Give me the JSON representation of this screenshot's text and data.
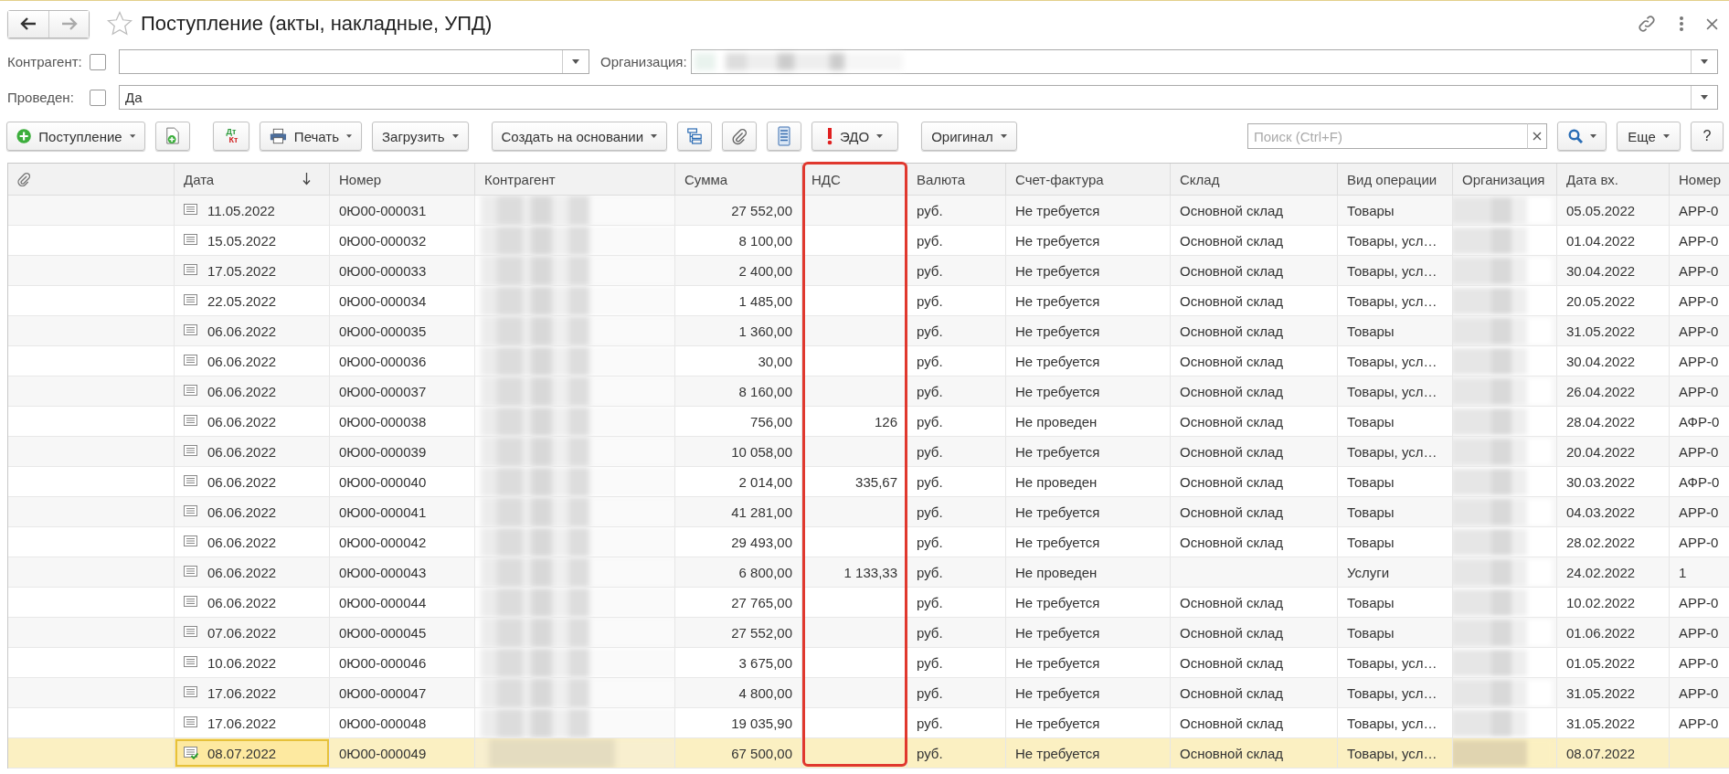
{
  "window": {
    "title": "Поступление (акты, накладные, УПД)"
  },
  "filters": {
    "counterparty": {
      "label": "Контрагент:",
      "checked": false
    },
    "organization": {
      "label": "Организация:"
    },
    "posted": {
      "label": "Проведен:",
      "checked": false,
      "value": "Да"
    }
  },
  "toolbar": [
    {
      "kind": "create",
      "label": "Поступление",
      "dropdown": true
    },
    {
      "kind": "copy"
    },
    {
      "kind": "dtkt",
      "label_top": "Дт",
      "label_bottom": "Кт"
    },
    {
      "kind": "print",
      "label": "Печать",
      "dropdown": true
    },
    {
      "kind": "text",
      "label": "Загрузить",
      "dropdown": true
    },
    {
      "kind": "text",
      "label": "Создать на основании",
      "dropdown": true
    },
    {
      "kind": "structure"
    },
    {
      "kind": "attach"
    },
    {
      "kind": "list"
    },
    {
      "kind": "edo",
      "label": "ЭДО",
      "dropdown": true
    },
    {
      "kind": "text",
      "label": "Оригинал",
      "dropdown": true
    }
  ],
  "search": {
    "placeholder": "Поиск (Ctrl+F)"
  },
  "more_button": {
    "label": "Еще"
  },
  "help_button": {
    "label": "?"
  },
  "table": {
    "columns": [
      {
        "kind": "attachment"
      },
      {
        "label": "Дата",
        "sorted": true
      },
      {
        "label": "Номер"
      },
      {
        "label": "Контрагент",
        "kind": "blurred"
      },
      {
        "label": "Сумма"
      },
      {
        "label": "НДС",
        "highlight": true
      },
      {
        "label": "Валюта"
      },
      {
        "label": "Счет-фактура"
      },
      {
        "label": "Склад"
      },
      {
        "label": "Вид операции"
      },
      {
        "label": "Организация",
        "kind": "blurred"
      },
      {
        "label": "Дата вх."
      },
      {
        "label": "Номер"
      }
    ],
    "rows": [
      {
        "date": "11.05.2022",
        "number": "0Ю00-000031",
        "amount": "27 552,00",
        "currency": "руб.",
        "invoice": "Не требуется",
        "warehouse": "Основной склад",
        "operation": "Товары",
        "date_in": "05.05.2022",
        "number_in": "АРР-0",
        "posted": false,
        "selected": false
      },
      {
        "date": "15.05.2022",
        "number": "0Ю00-000032",
        "amount": "8 100,00",
        "currency": "руб.",
        "invoice": "Не требуется",
        "warehouse": "Основной склад",
        "operation": "Товары, усл…",
        "date_in": "01.04.2022",
        "number_in": "АРР-0",
        "posted": false,
        "selected": false
      },
      {
        "date": "17.05.2022",
        "number": "0Ю00-000033",
        "amount": "2 400,00",
        "currency": "руб.",
        "invoice": "Не требуется",
        "warehouse": "Основной склад",
        "operation": "Товары, усл…",
        "date_in": "30.04.2022",
        "number_in": "АРР-0",
        "posted": false,
        "selected": false
      },
      {
        "date": "22.05.2022",
        "number": "0Ю00-000034",
        "amount": "1 485,00",
        "currency": "руб.",
        "invoice": "Не требуется",
        "warehouse": "Основной склад",
        "operation": "Товары, усл…",
        "date_in": "20.05.2022",
        "number_in": "АРР-0",
        "posted": false,
        "selected": false
      },
      {
        "date": "06.06.2022",
        "number": "0Ю00-000035",
        "amount": "1 360,00",
        "currency": "руб.",
        "invoice": "Не требуется",
        "warehouse": "Основной склад",
        "operation": "Товары",
        "date_in": "31.05.2022",
        "number_in": "АРР-0",
        "posted": false,
        "selected": false
      },
      {
        "date": "06.06.2022",
        "number": "0Ю00-000036",
        "amount": "30,00",
        "currency": "руб.",
        "invoice": "Не требуется",
        "warehouse": "Основной склад",
        "operation": "Товары, усл…",
        "date_in": "30.04.2022",
        "number_in": "АРР-0",
        "posted": false,
        "selected": false
      },
      {
        "date": "06.06.2022",
        "number": "0Ю00-000037",
        "amount": "8 160,00",
        "currency": "руб.",
        "invoice": "Не требуется",
        "warehouse": "Основной склад",
        "operation": "Товары, усл…",
        "date_in": "26.04.2022",
        "number_in": "АРР-0",
        "posted": false,
        "selected": false
      },
      {
        "date": "06.06.2022",
        "number": "0Ю00-000038",
        "amount": "756,00",
        "vat": "126",
        "currency": "руб.",
        "invoice": "Не проведен",
        "warehouse": "Основной склад",
        "operation": "Товары",
        "date_in": "28.04.2022",
        "number_in": "АФР-0",
        "posted": false,
        "selected": false
      },
      {
        "date": "06.06.2022",
        "number": "0Ю00-000039",
        "amount": "10 058,00",
        "currency": "руб.",
        "invoice": "Не требуется",
        "warehouse": "Основной склад",
        "operation": "Товары, усл…",
        "date_in": "20.04.2022",
        "number_in": "АРР-0",
        "posted": false,
        "selected": false
      },
      {
        "date": "06.06.2022",
        "number": "0Ю00-000040",
        "amount": "2 014,00",
        "vat": "335,67",
        "currency": "руб.",
        "invoice": "Не проведен",
        "warehouse": "Основной склад",
        "operation": "Товары",
        "date_in": "30.03.2022",
        "number_in": "АФР-0",
        "posted": false,
        "selected": false
      },
      {
        "date": "06.06.2022",
        "number": "0Ю00-000041",
        "amount": "41 281,00",
        "currency": "руб.",
        "invoice": "Не требуется",
        "warehouse": "Основной склад",
        "operation": "Товары",
        "date_in": "04.03.2022",
        "number_in": "АРР-0",
        "posted": false,
        "selected": false
      },
      {
        "date": "06.06.2022",
        "number": "0Ю00-000042",
        "amount": "29 493,00",
        "currency": "руб.",
        "invoice": "Не требуется",
        "warehouse": "Основной склад",
        "operation": "Товары",
        "date_in": "28.02.2022",
        "number_in": "АРР-0",
        "posted": false,
        "selected": false
      },
      {
        "date": "06.06.2022",
        "number": "0Ю00-000043",
        "amount": "6 800,00",
        "vat": "1 133,33",
        "currency": "руб.",
        "invoice": "Не проведен",
        "operation": "Услуги",
        "date_in": "24.02.2022",
        "number_in": "1",
        "posted": false,
        "selected": false
      },
      {
        "date": "06.06.2022",
        "number": "0Ю00-000044",
        "amount": "27 765,00",
        "currency": "руб.",
        "invoice": "Не требуется",
        "warehouse": "Основной склад",
        "operation": "Товары",
        "date_in": "10.02.2022",
        "number_in": "АРР-0",
        "posted": false,
        "selected": false
      },
      {
        "date": "07.06.2022",
        "number": "0Ю00-000045",
        "amount": "27 552,00",
        "currency": "руб.",
        "invoice": "Не требуется",
        "warehouse": "Основной склад",
        "operation": "Товары",
        "date_in": "01.06.2022",
        "number_in": "АРР-0",
        "posted": false,
        "selected": false
      },
      {
        "date": "10.06.2022",
        "number": "0Ю00-000046",
        "amount": "3 675,00",
        "currency": "руб.",
        "invoice": "Не требуется",
        "warehouse": "Основной склад",
        "operation": "Товары, усл…",
        "date_in": "01.05.2022",
        "number_in": "АРР-0",
        "posted": false,
        "selected": false
      },
      {
        "date": "17.06.2022",
        "number": "0Ю00-000047",
        "amount": "4 800,00",
        "currency": "руб.",
        "invoice": "Не требуется",
        "warehouse": "Основной склад",
        "operation": "Товары, усл…",
        "date_in": "31.05.2022",
        "number_in": "АРР-0",
        "posted": false,
        "selected": false
      },
      {
        "date": "17.06.2022",
        "number": "0Ю00-000048",
        "amount": "19 035,90",
        "currency": "руб.",
        "invoice": "Не требуется",
        "warehouse": "Основной склад",
        "operation": "Товары, усл…",
        "date_in": "31.05.2022",
        "number_in": "АРР-0",
        "posted": false,
        "selected": false
      },
      {
        "date": "08.07.2022",
        "number": "0Ю00-000049",
        "amount": "67 500,00",
        "currency": "руб.",
        "invoice": "Не требуется",
        "warehouse": "Основной склад",
        "operation": "Товары, усл…",
        "date_in": "08.07.2022",
        "posted": true,
        "selected": true
      }
    ]
  }
}
